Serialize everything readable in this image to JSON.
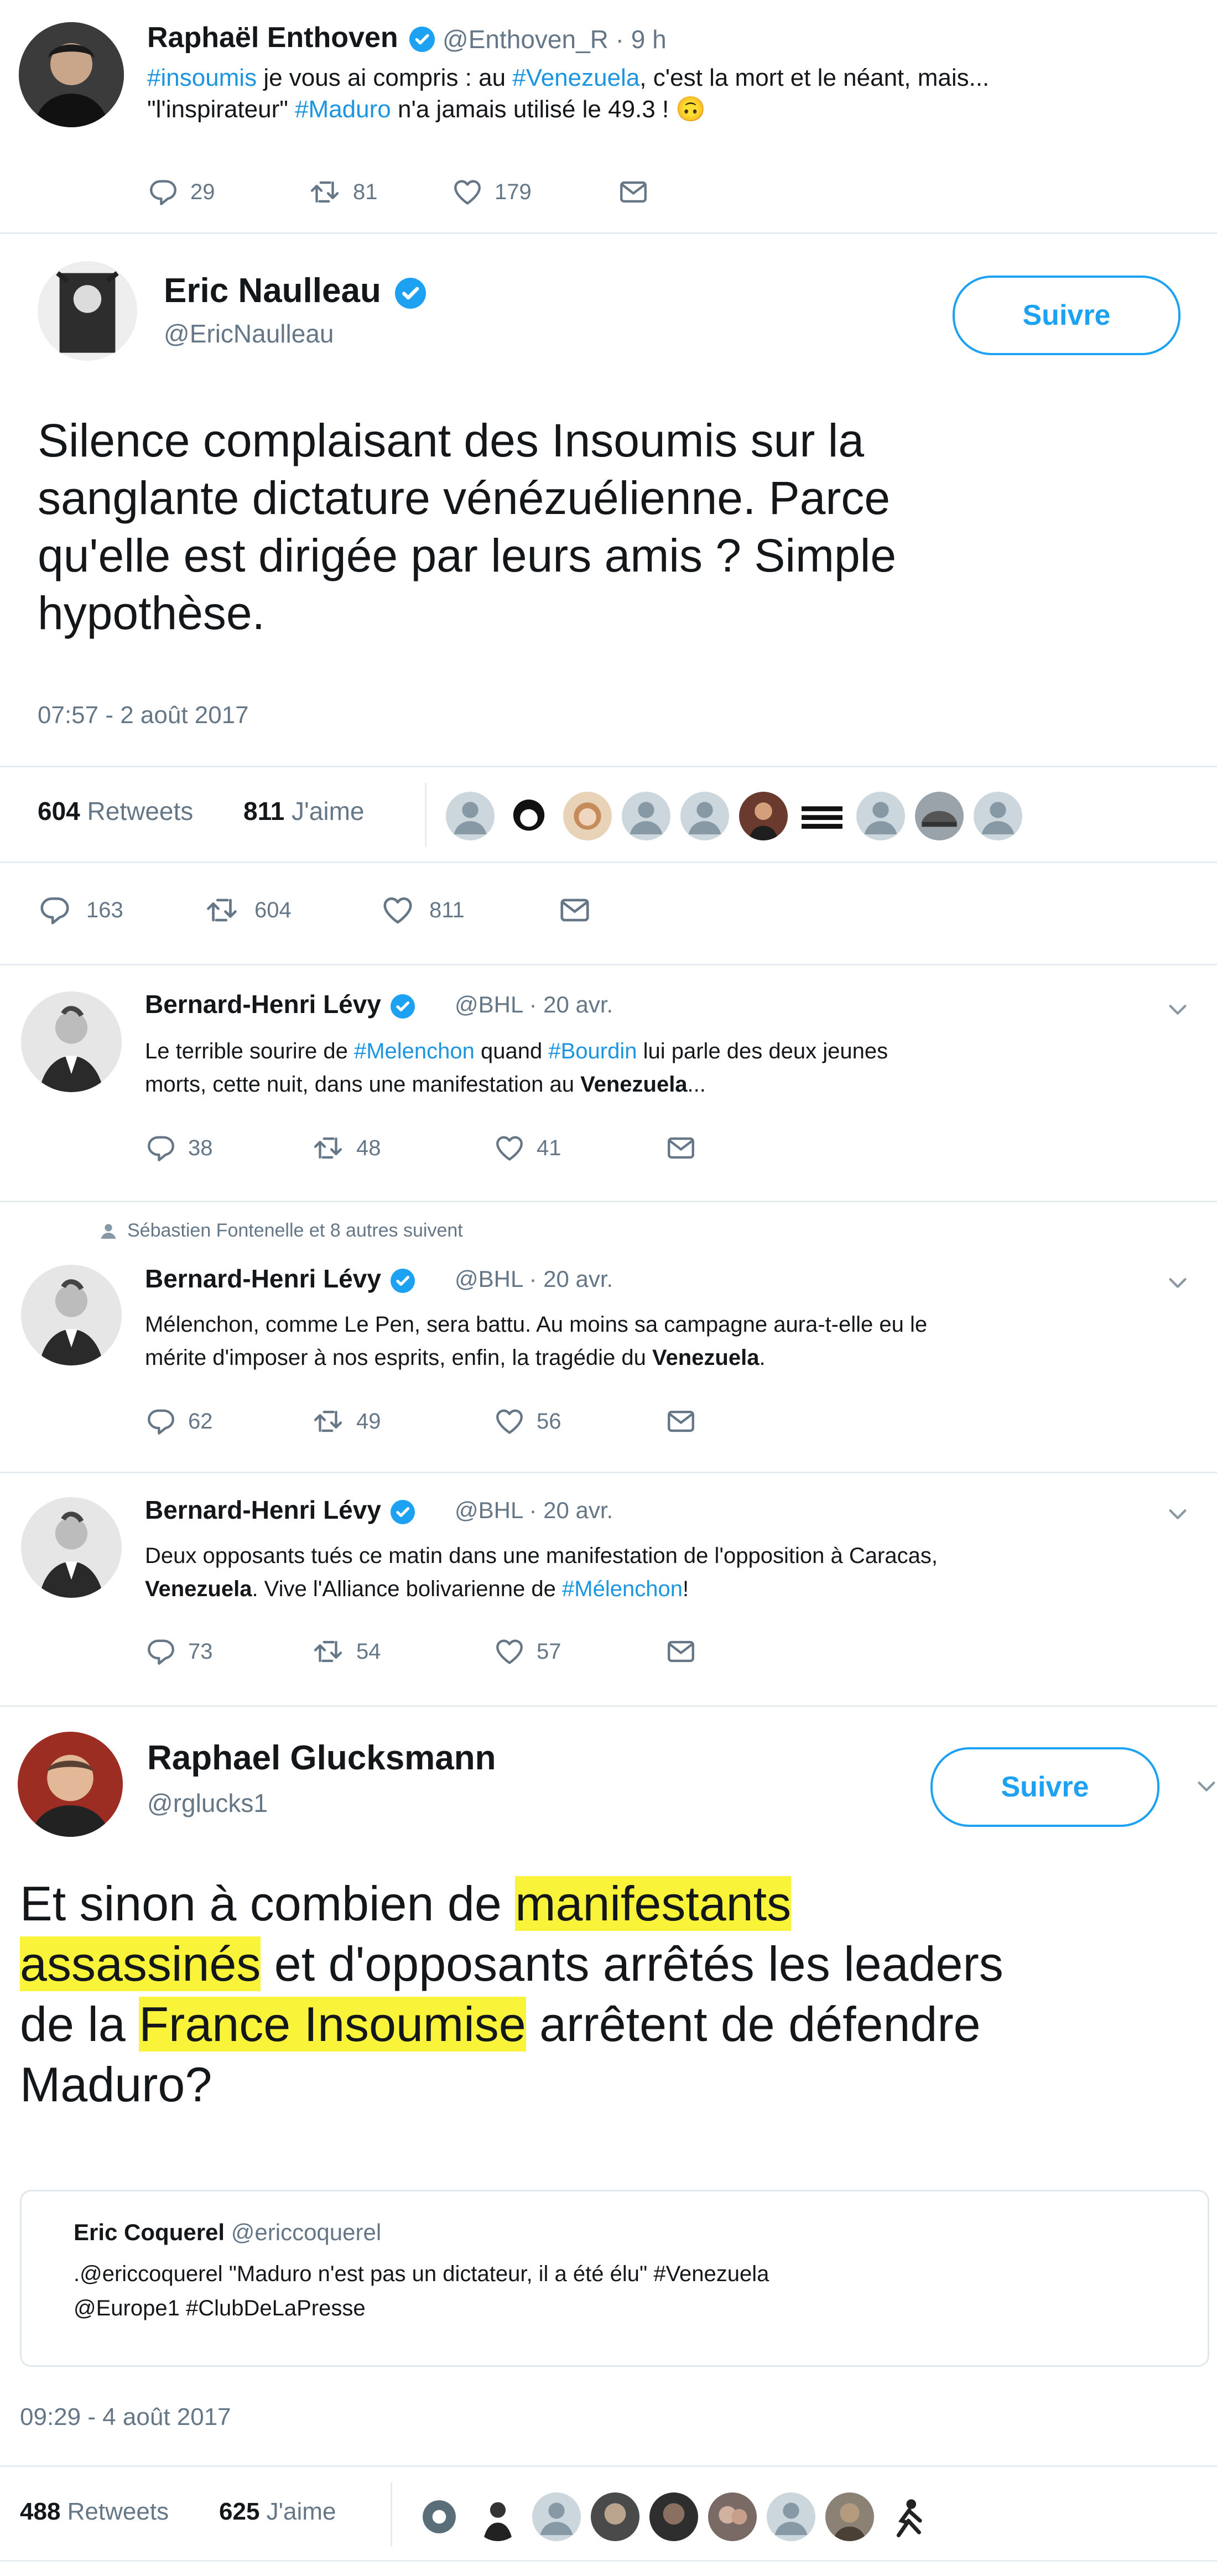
{
  "tweet1": {
    "name": "Raphaël Enthoven",
    "handle": "@Enthoven_R",
    "time": "· 9 h",
    "line1_tag1": "#insoumis",
    "line1_mid": " je vous ai compris : au ",
    "line1_tag2": "#Venezuela",
    "line1_end": ", c'est la mort et le néant, mais...",
    "line2_a": "\"l'inspirateur\" ",
    "line2_tag": "#Maduro",
    "line2_b": " n'a jamais utilisé le 49.3 ! ",
    "line2_emoji": "🙃",
    "replies": "29",
    "retweets": "81",
    "likes": "179"
  },
  "tweet2": {
    "name": "Eric Naulleau",
    "handle": "@EricNaulleau",
    "follow": "Suivre",
    "line1": "Silence complaisant des Insoumis sur la",
    "line2": "sanglante dictature vénézuélienne. Parce",
    "line3": "qu'elle est  dirigée par leurs amis ? Simple",
    "line4": "hypothèse.",
    "date": "07:57 - 2 août 2017",
    "rt_count": "604",
    "rt_label": "Retweets",
    "like_count": "811",
    "like_label": "J'aime",
    "replies": "163",
    "retweets": "604",
    "likes": "811"
  },
  "tweet3": {
    "name": "Bernard-Henri Lévy",
    "handle": "@BHL",
    "time": "· 20 avr.",
    "l1_a": "Le terrible sourire de ",
    "l1_tag1": "#Melenchon",
    "l1_b": " quand ",
    "l1_tag2": "#Bourdin",
    "l1_c": " lui parle des deux jeunes",
    "l2_a": "morts, cette nuit, dans une manifestation au ",
    "l2_bold": "Venezuela",
    "l2_c": "...",
    "replies": "38",
    "retweets": "48",
    "likes": "41"
  },
  "tweet4": {
    "context": "Sébastien Fontenelle et 8 autres suivent",
    "name": "Bernard-Henri Lévy",
    "handle": "@BHL",
    "time": "· 20 avr.",
    "l1": "Mélenchon, comme Le Pen, sera battu. Au moins sa campagne aura-t-elle eu le",
    "l2_a": "mérite d'imposer à nos esprits, enfin, la tragédie du ",
    "l2_bold": "Venezuela",
    "l2_c": ".",
    "replies": "62",
    "retweets": "49",
    "likes": "56"
  },
  "tweet5": {
    "name": "Bernard-Henri Lévy",
    "handle": "@BHL",
    "time": "· 20 avr.",
    "l1": "Deux opposants tués ce matin dans une manifestation de l'opposition à Caracas,",
    "l2_bold": "Venezuela",
    "l2_a": ". Vive l'Alliance bolivarienne de ",
    "l2_tag": "#Mélenchon",
    "l2_c": "!",
    "replies": "73",
    "retweets": "54",
    "likes": "57"
  },
  "tweet6": {
    "name": "Raphael Glucksmann",
    "handle": "@rglucks1",
    "follow": "Suivre",
    "l1_a": "Et sinon à combien de ",
    "l1_mark": "manifestants",
    "l2_mark": "assassinés",
    "l2_b": " et d'opposants arrêtés les leaders",
    "l3_a": "de la ",
    "l3_mark": "France Insoumise",
    "l3_b": " arrêtent de défendre",
    "l4": "Maduro?",
    "quote_name": "Eric Coquerel",
    "quote_handle": "@ericcoquerel",
    "quote_l1": ".@ericcoquerel \"Maduro n'est pas un dictateur, il a été élu\" #Venezuela",
    "quote_l2": "@Europe1 #ClubDeLaPresse",
    "date": "09:29 - 4 août 2017",
    "rt_count": "488",
    "rt_label": "Retweets",
    "like_count": "625",
    "like_label": "J'aime"
  },
  "icons": {
    "reply": "reply-icon",
    "retweet": "retweet-icon",
    "like": "heart-icon",
    "dm": "envelope-icon",
    "verified": "verified-badge-icon",
    "chevron": "chevron-down-icon"
  },
  "colors": {
    "link": "#1b95e0",
    "accent": "#1da1f2",
    "muted": "#657786",
    "highlight": "#f9f339"
  }
}
